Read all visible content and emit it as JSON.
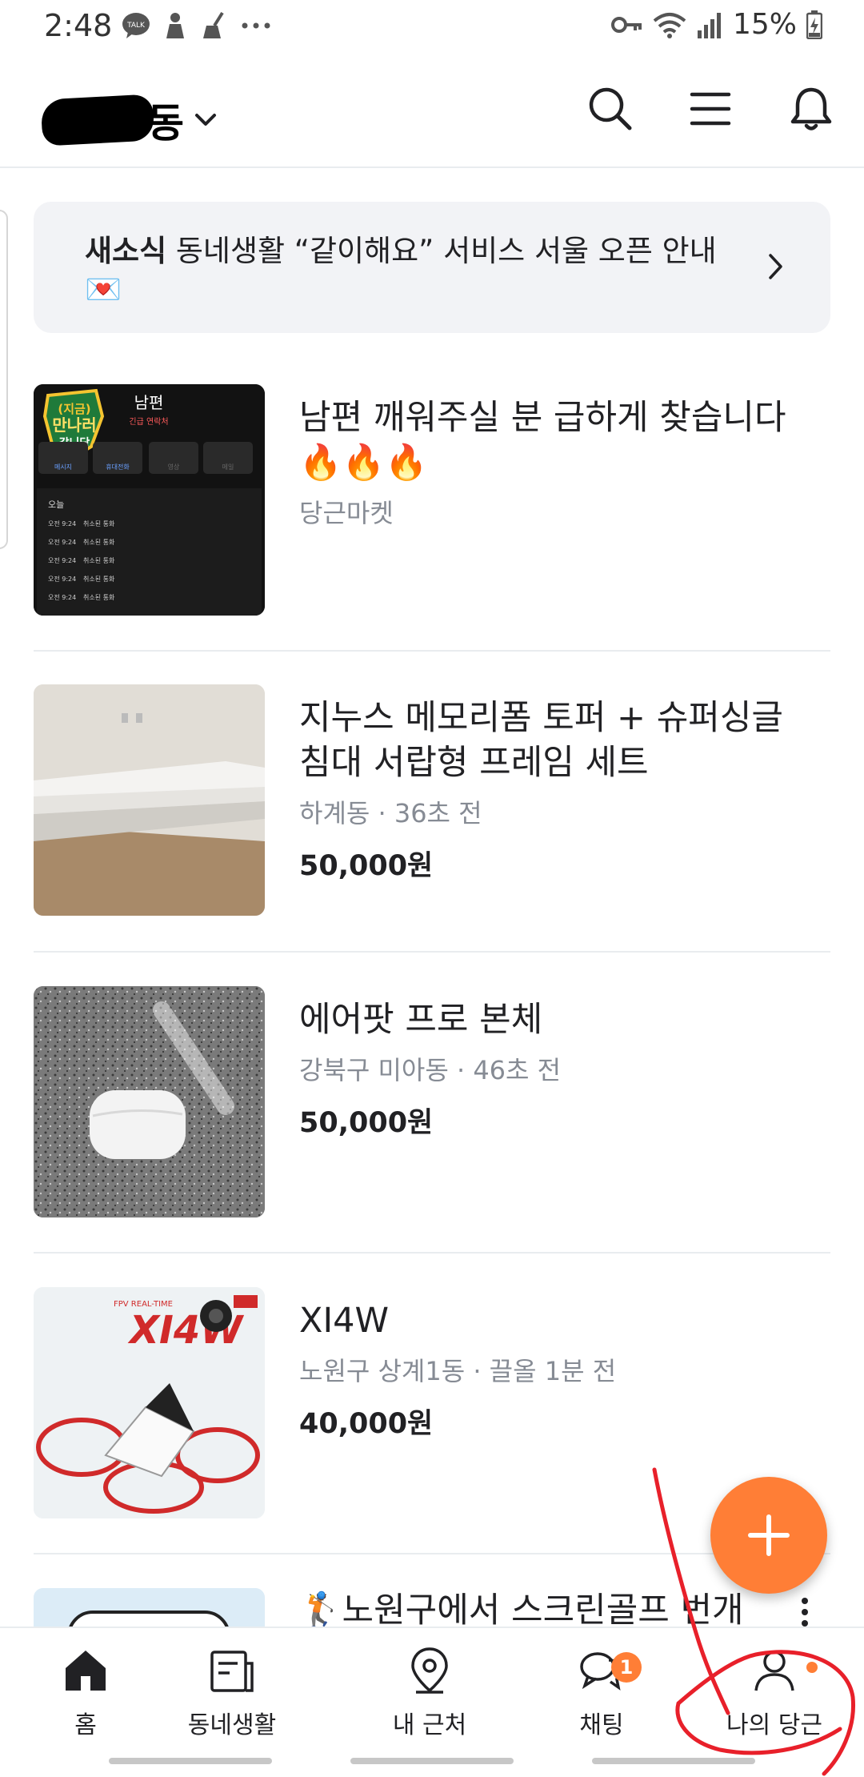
{
  "status_bar": {
    "time": "2:48",
    "battery": "15%"
  },
  "header": {
    "location_suffix": "동",
    "icons": [
      "search-icon",
      "menu-icon",
      "bell-icon"
    ]
  },
  "notice": {
    "label": "새소식",
    "text": " 동네생활 “같이해요” 서비스 서울 오픈 안내 💌"
  },
  "items": [
    {
      "title": "남편 깨워주실 분 급하게 찾습니다🔥🔥🔥",
      "meta": "당근마켓",
      "price": "",
      "thumb": {
        "badge_top": "(지금)",
        "badge_main": "만나러",
        "badge_sub": "갑니당",
        "caller": "남편",
        "caller_sub": "긴급 연락처",
        "buttons": [
          "메시지",
          "휴대전화",
          "영상",
          "메일"
        ],
        "day": "오늘",
        "log_time": "오전 9:24",
        "log_text": "취소된 통화"
      }
    },
    {
      "title": "지누스 메모리폼 토퍼 + 슈퍼싱글 침대 서랍형 프레임 세트",
      "meta": "하계동 · 36초 전",
      "price": "50,000원"
    },
    {
      "title": "에어팟 프로 본체",
      "meta": "강북구 미아동 · 46초 전",
      "price": "50,000원"
    },
    {
      "title": "XI4W",
      "meta": "노원구 상계1동 · 끌올 1분 전",
      "price": "40,000원",
      "thumb": {
        "box_text": "XI4W",
        "box_sub": "FPV REAL-TIME"
      }
    },
    {
      "title": "🏌️노원구에서 스크린골프 번개",
      "meta": "",
      "price": ""
    }
  ],
  "fab": {
    "label": "+"
  },
  "bottom_nav": [
    {
      "label": "홈",
      "icon": "home-icon"
    },
    {
      "label": "동네생활",
      "icon": "community-icon"
    },
    {
      "label": "내 근처",
      "icon": "location-pin-icon"
    },
    {
      "label": "채팅",
      "icon": "chat-icon",
      "badge": "1"
    },
    {
      "label": "나의 당근",
      "icon": "profile-icon"
    }
  ],
  "colors": {
    "accent": "#ff7e36",
    "text": "#212124",
    "meta": "#868b94",
    "divider": "#e9ecef",
    "annotation": "#e8202a"
  }
}
